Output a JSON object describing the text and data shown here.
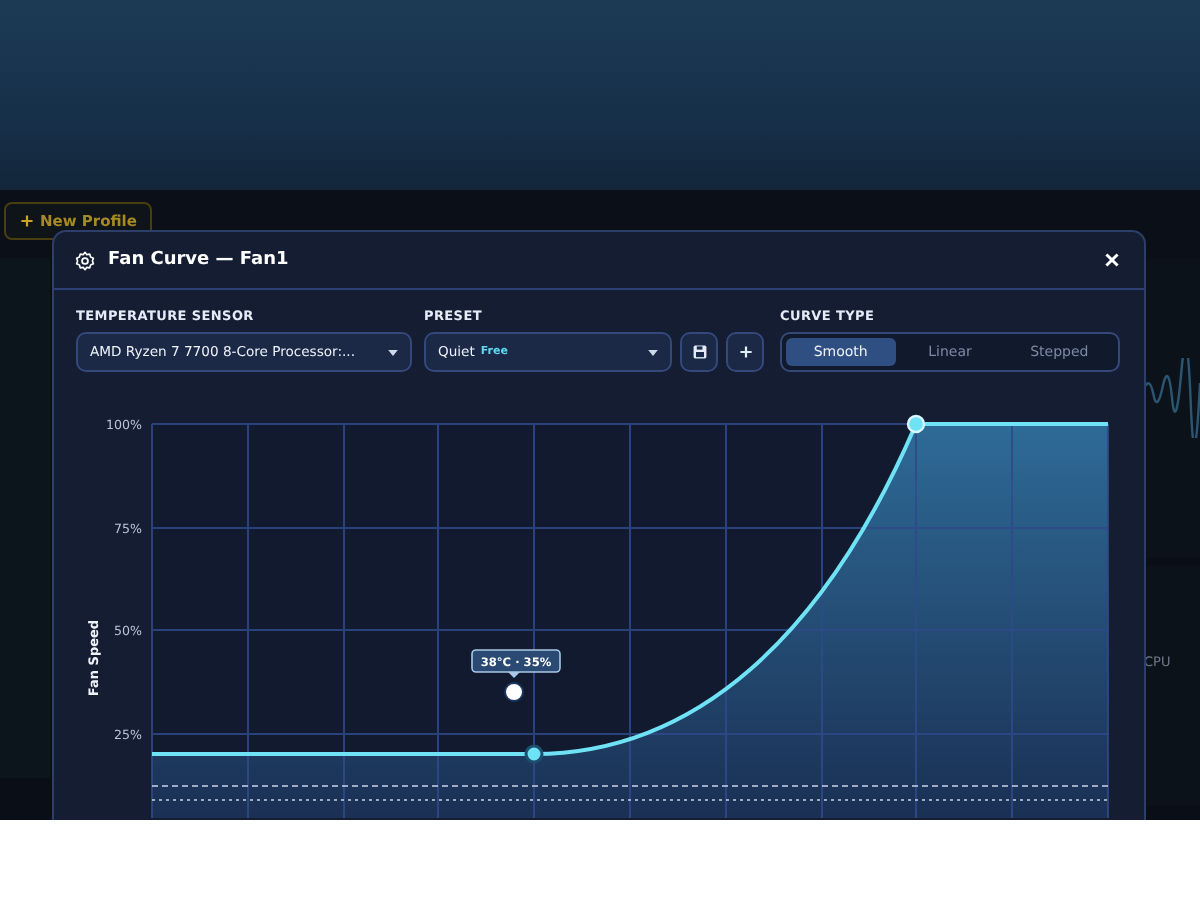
{
  "background": {
    "new_profile_button": "New Profile",
    "cpu_label": "CPU"
  },
  "window": {
    "title": "Fan Curve — Fan1"
  },
  "controls": {
    "sensor": {
      "label": "TEMPERATURE SENSOR",
      "value": "AMD Ryzen 7 7700 8-Core Processor:..."
    },
    "preset": {
      "label": "PRESET",
      "value": "Quiet",
      "badge": "Free"
    },
    "curve_type": {
      "label": "CURVE TYPE",
      "options": [
        {
          "label": "Smooth",
          "selected": true
        },
        {
          "label": "Linear",
          "selected": false
        },
        {
          "label": "Stepped",
          "selected": false
        }
      ]
    }
  },
  "chart": {
    "ylabel": "Fan Speed",
    "yticks": [
      "100%",
      "75%",
      "50%",
      "25%"
    ],
    "tooltip": "38°C · 35%"
  }
}
